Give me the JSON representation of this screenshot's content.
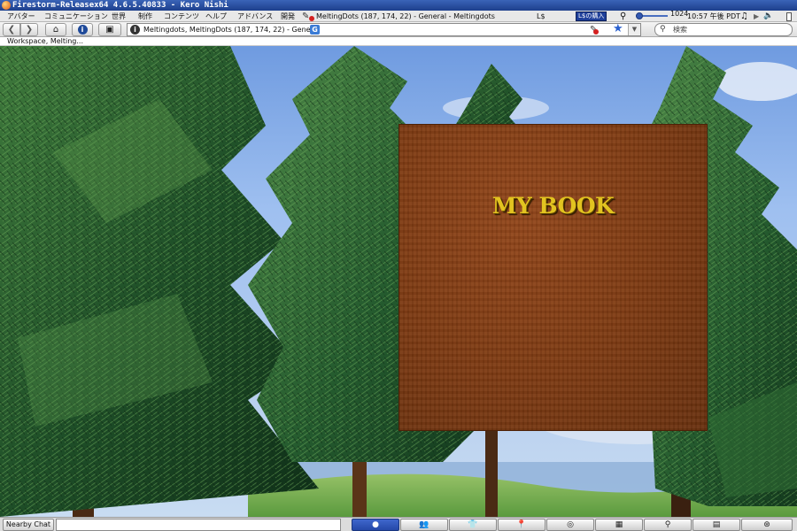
{
  "window": {
    "title": "Firestorm-Releasex64 4.6.5.40833 - Kero Nishi"
  },
  "menubar": {
    "items": [
      "アバター",
      "コミュニケーション",
      "世界",
      "制作",
      "コンテンツ",
      "ヘルプ",
      "アドバンス",
      "開発"
    ],
    "location": "MeltingDots (187, 174, 22) - General - Meltingdots",
    "currency": "L$",
    "buy_label": "L$の購入",
    "fps": "1024",
    "clock": "10:57 午後 PDT"
  },
  "navbar": {
    "address": "Meltingdots, MeltingDots (187, 174, 22) - General",
    "address_badge": "G",
    "search_placeholder": "検索"
  },
  "status_strip": {
    "text": "Workspace, Melting..."
  },
  "scene": {
    "book_title": "MY BOOK"
  },
  "bottombar": {
    "nearby_chat_label": "Nearby Chat",
    "chat_value": "",
    "toolbar_buttons": [
      {
        "icon": "speech-bubble-icon",
        "active": true
      },
      {
        "icon": "people-icon",
        "active": false
      },
      {
        "icon": "shirt-icon",
        "active": false
      },
      {
        "icon": "places-pin-icon",
        "active": false
      },
      {
        "icon": "radar-icon",
        "active": false
      },
      {
        "icon": "map-icon",
        "active": false
      },
      {
        "icon": "search-icon",
        "active": false
      },
      {
        "icon": "clipboard-icon",
        "active": false
      },
      {
        "icon": "help-lifebuoy-icon",
        "active": false
      }
    ]
  },
  "colors": {
    "titlebar": "#2a4fa0",
    "book_cover": "#7d3a12",
    "book_title": "#e2c320",
    "active_button": "#2f55b8"
  }
}
